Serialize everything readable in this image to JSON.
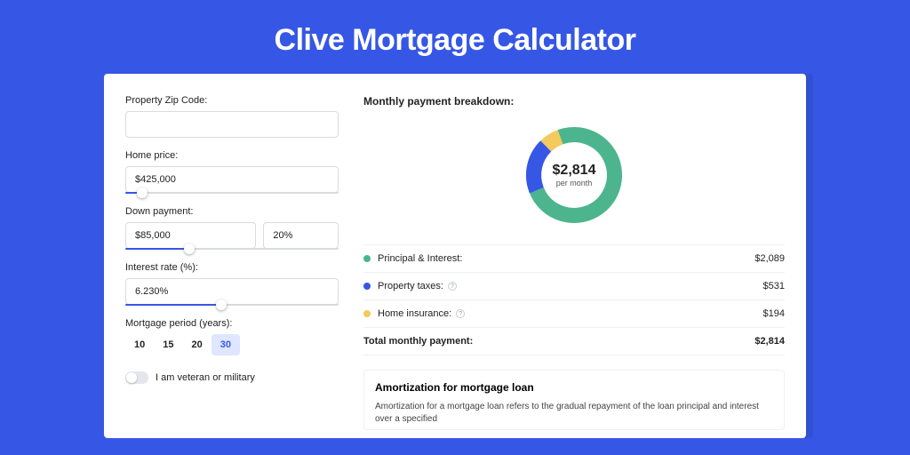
{
  "page_title": "Clive Mortgage Calculator",
  "form": {
    "zip_label": "Property Zip Code:",
    "zip_value": "",
    "home_price_label": "Home price:",
    "home_price_value": "$425,000",
    "home_price_fill_pct": 8,
    "down_payment_label": "Down payment:",
    "down_payment_value": "$85,000",
    "down_payment_pct_value": "20%",
    "down_payment_fill_pct": 30,
    "interest_label": "Interest rate (%):",
    "interest_value": "6.230%",
    "interest_fill_pct": 45,
    "period_label": "Mortgage period (years):",
    "periods": [
      "10",
      "15",
      "20",
      "30"
    ],
    "period_active_index": 3,
    "veteran_label": "I am veteran or military",
    "veteran_on": false
  },
  "breakdown": {
    "title": "Monthly payment breakdown:",
    "center_value": "$2,814",
    "center_sub": "per month",
    "items": [
      {
        "label": "Principal & Interest:",
        "value": "$2,089",
        "color": "#4CB58E",
        "has_info": false
      },
      {
        "label": "Property taxes:",
        "value": "$531",
        "color": "#3657E5",
        "has_info": true
      },
      {
        "label": "Home insurance:",
        "value": "$194",
        "color": "#F4C95D",
        "has_info": true
      }
    ],
    "total_label": "Total monthly payment:",
    "total_value": "$2,814"
  },
  "amort": {
    "title": "Amortization for mortgage loan",
    "text": "Amortization for a mortgage loan refers to the gradual repayment of the loan principal and interest over a specified"
  },
  "chart_data": {
    "type": "pie",
    "title": "Monthly payment breakdown",
    "series": [
      {
        "name": "Principal & Interest",
        "value": 2089,
        "color": "#4CB58E"
      },
      {
        "name": "Property taxes",
        "value": 531,
        "color": "#3657E5"
      },
      {
        "name": "Home insurance",
        "value": 194,
        "color": "#F4C95D"
      }
    ],
    "total": 2814
  }
}
